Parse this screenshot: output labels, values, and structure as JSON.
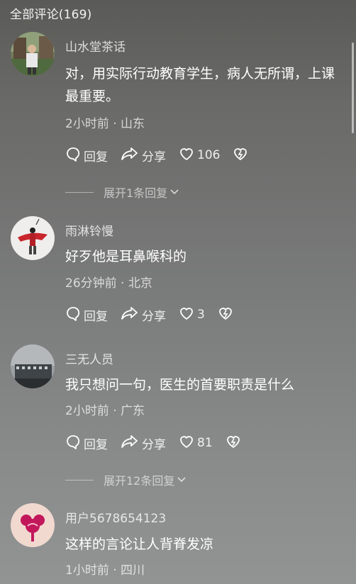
{
  "header": {
    "title": "全部评论(169)"
  },
  "comments": [
    {
      "username": "山水堂茶话",
      "text": "对，用实际行动教育学生，病人无所谓，上课最重要。",
      "meta": "2小时前 · 山东",
      "reply_label": "回复",
      "share_label": "分享",
      "like_count": "106",
      "expand_label": "展开1条回复"
    },
    {
      "username": "雨淋铃慢",
      "text": "好歹他是耳鼻喉科的",
      "meta": "26分钟前 · 北京",
      "reply_label": "回复",
      "share_label": "分享",
      "like_count": "3"
    },
    {
      "username": "三无人员",
      "text": "我只想问一句，医生的首要职责是什么",
      "meta": "2小时前 · 广东",
      "reply_label": "回复",
      "share_label": "分享",
      "like_count": "81",
      "expand_label": "展开12条回复"
    },
    {
      "username": "用户5678654123",
      "text": "这样的言论让人背脊发凉",
      "meta": "1小时前 · 四川"
    }
  ],
  "icons": [
    "comment-reply-icon",
    "share-arrow-icon",
    "heart-icon",
    "broken-heart-icon",
    "chevron-down-icon"
  ],
  "colors": {
    "text": "#ffffff",
    "muted": "#d0d0d0",
    "background_top": "#5a5a57",
    "background_bottom": "#929494"
  }
}
